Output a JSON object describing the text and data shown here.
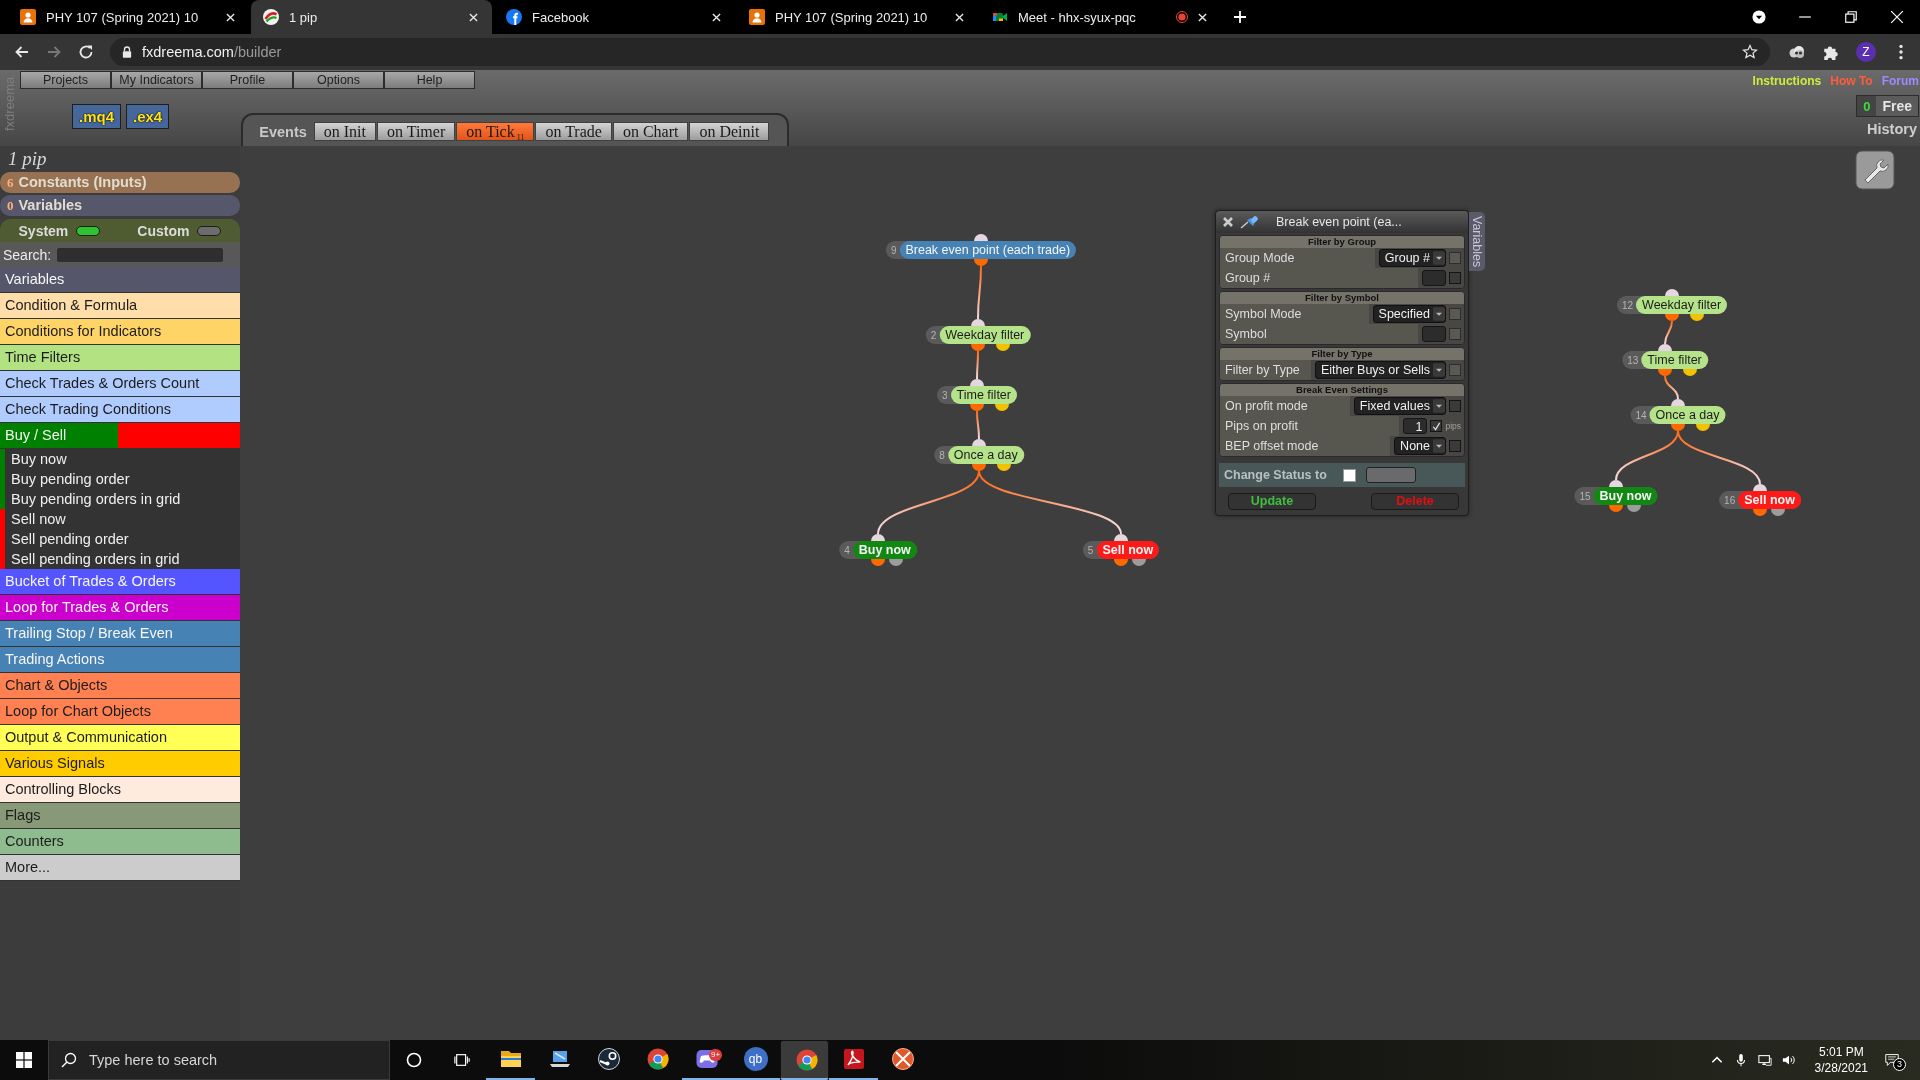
{
  "browser": {
    "tabs": [
      {
        "title": "PHY 107 (Spring 2021) 10",
        "kind": "course",
        "selected": false,
        "recording": false
      },
      {
        "title": "1 pip",
        "kind": "builder",
        "selected": true,
        "recording": false
      },
      {
        "title": "Facebook",
        "kind": "social",
        "selected": false,
        "recording": false
      },
      {
        "title": "PHY 107 (Spring 2021) 10",
        "kind": "course",
        "selected": false,
        "recording": false
      },
      {
        "title": "Meet - hhx-syux-pqc",
        "kind": "meeting",
        "selected": false,
        "recording": true
      }
    ],
    "address": {
      "host": "fxdreema.com",
      "path": "/builder"
    },
    "profile": "Z"
  },
  "header": {
    "brand": "fxdreema",
    "menu": [
      "Projects",
      "My Indicators",
      "Profile",
      "Options",
      "Help"
    ],
    "exports": [
      ".mq4",
      ".ex4"
    ],
    "links": [
      {
        "label": "Instructions",
        "color": "#c8f03c"
      },
      {
        "label": "How To",
        "color": "#ff5c3a"
      },
      {
        "label": "Forum",
        "color": "#9a8cff"
      }
    ],
    "plan": {
      "count": "0",
      "label": "Free"
    },
    "history": "History",
    "events": {
      "label": "Events",
      "tabs": [
        {
          "label": "on Init",
          "selected": false
        },
        {
          "label": "on Timer",
          "selected": false
        },
        {
          "label": "on Tick",
          "selected": true,
          "badge": "11"
        },
        {
          "label": "on Trade",
          "selected": false
        },
        {
          "label": "on Chart",
          "selected": false
        },
        {
          "label": "on Deinit",
          "selected": false
        }
      ]
    }
  },
  "sidebar": {
    "project": "1 pip",
    "constants": {
      "count": "6",
      "label": "Constants (Inputs)"
    },
    "variables": {
      "count": "0",
      "label": "Variables"
    },
    "toggles": [
      {
        "label": "System",
        "on": true
      },
      {
        "label": "Custom",
        "on": false
      }
    ],
    "search": {
      "label": "Search:"
    },
    "categories": [
      {
        "label": "Variables",
        "color": "#56566a"
      },
      {
        "label": "Condition & Formula",
        "color": "#ffdeaa"
      },
      {
        "label": "Conditions for Indicators",
        "color": "#ffd466"
      },
      {
        "label": "Time Filters",
        "color": "#b2e282"
      },
      {
        "label": "Check Trades & Orders Count",
        "color": "#b0ccff"
      },
      {
        "label": "Check Trading Conditions",
        "color": "#b0ccff"
      },
      {
        "label": "Buy / Sell",
        "kind": "group",
        "color": "#008000",
        "expanded": true,
        "children": [
          {
            "label": "Buy now",
            "color": "#008000"
          },
          {
            "label": "Buy pending order",
            "color": "#008000"
          },
          {
            "label": "Buy pending orders in grid",
            "color": "#008000"
          },
          {
            "label": "Sell now",
            "color": "#ff0000"
          },
          {
            "label": "Sell pending order",
            "color": "#ff0000"
          },
          {
            "label": "Sell pending orders in grid",
            "color": "#ff0000"
          }
        ]
      },
      {
        "label": "Bucket of Trades & Orders",
        "color": "#5555ff"
      },
      {
        "label": "Loop for Trades & Orders",
        "color": "#cc00cc"
      },
      {
        "label": "Trailing Stop / Break Even",
        "color": "#4682b4"
      },
      {
        "label": "Trading Actions",
        "color": "#4682b4"
      },
      {
        "label": "Chart & Objects",
        "color": "#ff8050"
      },
      {
        "label": "Loop for Chart Objects",
        "color": "#ff8050"
      },
      {
        "label": "Output & Communication",
        "color": "#ffff55"
      },
      {
        "label": "Various Signals",
        "color": "#ffcc00"
      },
      {
        "label": "Controlling Blocks",
        "color": "#ffeade"
      },
      {
        "label": "Flags",
        "color": "#889977"
      },
      {
        "label": "Counters",
        "color": "#8fbc8f"
      },
      {
        "label": "More...",
        "color": "#cccccc"
      }
    ]
  },
  "canvas": {
    "nodes": [
      {
        "number": "9",
        "label": "Break even point (each trade)",
        "kind": "action",
        "color": "#4682b4",
        "children": [
          {
            "number": "2",
            "label": "Weekday filter",
            "kind": "filter",
            "color": "#b5e38a",
            "children": [
              {
                "number": "3",
                "label": "Time filter",
                "kind": "filter",
                "color": "#b5e38a",
                "children": [
                  {
                    "number": "8",
                    "label": "Once a day",
                    "kind": "filter",
                    "color": "#b5e38a",
                    "children": [
                      {
                        "number": "4",
                        "label": "Buy now",
                        "kind": "trade",
                        "color": "#118811"
                      },
                      {
                        "number": "5",
                        "label": "Sell now",
                        "kind": "trade",
                        "color": "#ff1a1a"
                      }
                    ]
                  }
                ]
              }
            ]
          }
        ]
      },
      {
        "number": "12",
        "label": "Weekday filter",
        "kind": "filter",
        "color": "#b5e38a",
        "children": [
          {
            "number": "13",
            "label": "Time filter",
            "kind": "filter",
            "color": "#b5e38a",
            "children": [
              {
                "number": "14",
                "label": "Once a day",
                "kind": "filter",
                "color": "#b5e38a",
                "children": [
                  {
                    "number": "15",
                    "label": "Buy now",
                    "kind": "trade",
                    "color": "#118811"
                  },
                  {
                    "number": "16",
                    "label": "Sell now",
                    "kind": "trade",
                    "color": "#ff1a1a"
                  }
                ]
              }
            ]
          }
        ]
      }
    ]
  },
  "dialog": {
    "title": "Break even point (ea...",
    "side_tab": "Variables",
    "sections": [
      {
        "title": "Filter by Group",
        "rows": [
          {
            "label": "Group Mode",
            "kind": "select",
            "value": "Group #",
            "checked": false,
            "disabled": true
          },
          {
            "label": "Group #",
            "kind": "input",
            "checked": false,
            "disabled": false
          }
        ]
      },
      {
        "title": "Filter by Symbol",
        "rows": [
          {
            "label": "Symbol Mode",
            "kind": "select",
            "value": "Specified",
            "checked": false,
            "disabled": true
          },
          {
            "label": "Symbol",
            "kind": "input",
            "checked": false,
            "disabled": true
          }
        ]
      },
      {
        "title": "Filter by Type",
        "rows": [
          {
            "label": "Filter by Type",
            "kind": "select",
            "value": "Either Buys or Sells",
            "checked": false,
            "disabled": true
          }
        ]
      },
      {
        "title": "Break Even Settings",
        "rows": [
          {
            "label": "On profit mode",
            "kind": "select",
            "value": "Fixed values",
            "checked": false,
            "disabled": false
          },
          {
            "label": "Pips on profit",
            "kind": "input",
            "value": "1",
            "checked": true,
            "disabled": false,
            "unit": "pips"
          },
          {
            "label": "BEP offset mode",
            "kind": "select",
            "value": "None",
            "checked": false,
            "disabled": false
          }
        ]
      }
    ],
    "status": {
      "label": "Change Status to",
      "checked": false
    },
    "buttons": [
      {
        "label": "Update",
        "kind": "update"
      },
      {
        "label": "Delete",
        "kind": "delete"
      }
    ]
  },
  "taskbar": {
    "search_placeholder": "Type here to search",
    "apps": [
      {
        "kind": "folder",
        "running": true,
        "selected": false
      },
      {
        "kind": "laptop",
        "running": false,
        "selected": false
      },
      {
        "kind": "disc",
        "running": false,
        "selected": false
      },
      {
        "kind": "browser",
        "running": false,
        "selected": false
      },
      {
        "kind": "controller",
        "running": true,
        "selected": false,
        "badge": "9+"
      },
      {
        "kind": "monogram",
        "label": "qb",
        "running": true,
        "selected": false
      },
      {
        "kind": "browser",
        "running": true,
        "selected": true
      },
      {
        "kind": "pdf",
        "running": true,
        "selected": false
      },
      {
        "kind": "ball",
        "running": false,
        "selected": false
      }
    ],
    "time": "5:01 PM",
    "date": "3/28/2021",
    "notifications": "3"
  }
}
